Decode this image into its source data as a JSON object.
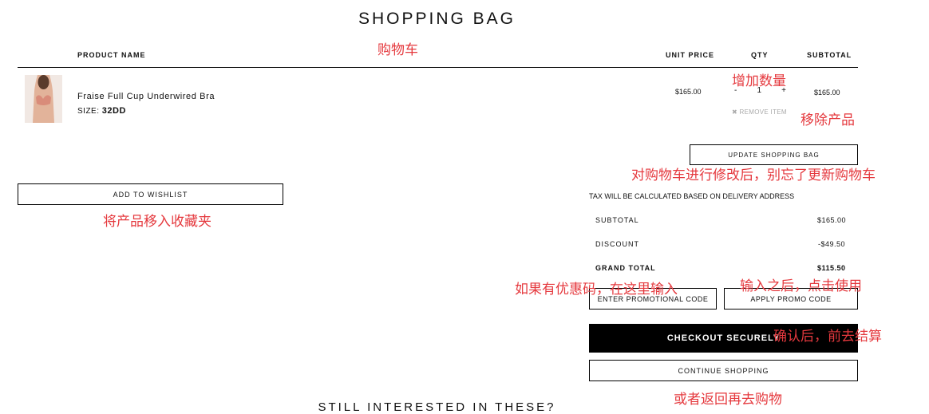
{
  "page": {
    "title": "SHOPPING BAG"
  },
  "table_headers": {
    "product": "PRODUCT NAME",
    "unit_price": "UNIT PRICE",
    "qty": "QTY",
    "subtotal": "SUBTOTAL"
  },
  "item": {
    "name": "Fraise Full Cup Underwired Bra",
    "size_label": "SIZE:",
    "size_value": "32DD",
    "unit_price": "$165.00",
    "qty_minus": "-",
    "qty_value": "1",
    "qty_plus": "+",
    "subtotal": "$165.00",
    "remove_icon": "✖",
    "remove_label": "REMOVE ITEM"
  },
  "buttons": {
    "update": "UPDATE SHOPPING BAG",
    "wishlist": "ADD TO WISHLIST",
    "apply_promo": "APPLY PROMO CODE",
    "checkout": "CHECKOUT SECURELY",
    "continue": "CONTINUE SHOPPING"
  },
  "summary": {
    "tax_note": "TAX WILL BE CALCULATED BASED ON DELIVERY ADDRESS",
    "subtotal_label": "SUBTOTAL",
    "subtotal_value": "$165.00",
    "discount_label": "DISCOUNT",
    "discount_value": "-$49.50",
    "grand_label": "GRAND TOTAL",
    "grand_value": "$115.50"
  },
  "promo": {
    "placeholder": "ENTER PROMOTIONAL CODE"
  },
  "recommend": {
    "title": "STILL INTERESTED IN THESE?"
  },
  "annotations": {
    "cart": "购物车",
    "add_qty": "增加数量",
    "remove_product": "移除产品",
    "update_reminder": "对购物车进行修改后，别忘了更新购物车",
    "wishlist": "将产品移入收藏夹",
    "promo_input": "如果有优惠码，在这里输入",
    "promo_apply": "输入之后，点击使用",
    "checkout": "确认后，前去结算",
    "continue": "或者返回再去购物"
  },
  "colors": {
    "annotation": "#e5393e",
    "checkout_bg": "#000000"
  }
}
